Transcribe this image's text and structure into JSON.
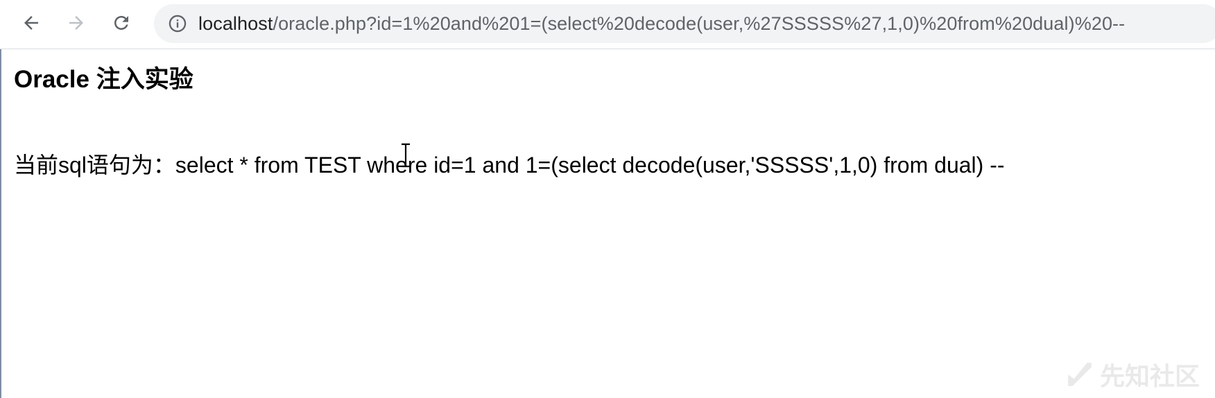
{
  "browser": {
    "url_host": "localhost",
    "url_path": "/oracle.php?id=1%20and%201=(select%20decode(user,%27SSSSS%27,1,0)%20from%20dual)%20--",
    "icons": {
      "back": "back-arrow-icon",
      "forward": "forward-arrow-icon",
      "reload": "reload-icon",
      "info": "info-icon"
    }
  },
  "page": {
    "heading": "Oracle 注入实验",
    "sql_statement": "当前sql语句为：select * from TEST where id=1 and 1=(select decode(user,'SSSSS',1,0) from dual) --"
  },
  "watermark": {
    "text": "先知社区",
    "icon": "xianzhi-logo-icon"
  },
  "colors": {
    "toolbar_bg": "#ffffff",
    "omnibox_bg": "#f1f3f4",
    "icon_active": "#5f6368",
    "icon_disabled": "#bdc1c6",
    "text": "#000000"
  }
}
